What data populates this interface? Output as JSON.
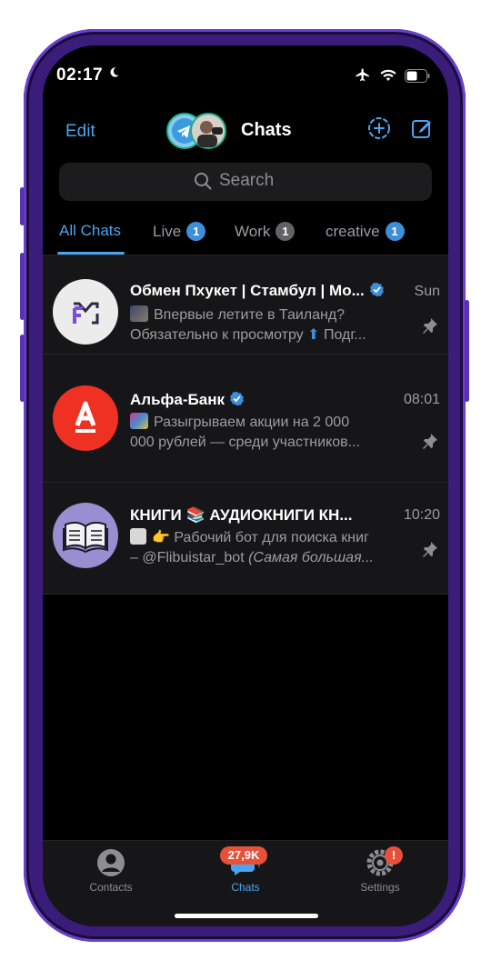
{
  "status": {
    "time": "02:17"
  },
  "header": {
    "edit_label": "Edit",
    "title": "Chats"
  },
  "search": {
    "placeholder": "Search"
  },
  "folders": [
    {
      "label": "All Chats"
    },
    {
      "label": "Live",
      "badge": "1"
    },
    {
      "label": "Work",
      "badge": "1"
    },
    {
      "label": "creative",
      "badge": "1"
    }
  ],
  "chats": [
    {
      "name": "Обмен Пхукет | Стамбул | Мо...",
      "time": "Sun",
      "line1": "Впервые летите в Таиланд?",
      "line2": "Обязательно к просмотру",
      "line2_tail": "Подг..."
    },
    {
      "name": "Альфа-Банк",
      "time": "08:01",
      "line1": "Разыгрываем акции на 2 000",
      "line2": "000 рублей — среди участников..."
    },
    {
      "name": "КНИГИ 📚 АУДИОКНИГИ КН...",
      "time": "10:20",
      "line1": "👉 Рабочий бот для поиска книг",
      "line2": "– @Flibuistar_bot",
      "line2_italic": "(Самая большая..."
    }
  ],
  "tabbar": {
    "contacts_label": "Contacts",
    "chats_label": "Chats",
    "chats_badge": "27,9K",
    "settings_label": "Settings",
    "settings_badge": "!"
  },
  "colors": {
    "accent": "#4aa6f0",
    "badge_red": "#e8503a",
    "alfa_red": "#ef3124"
  }
}
